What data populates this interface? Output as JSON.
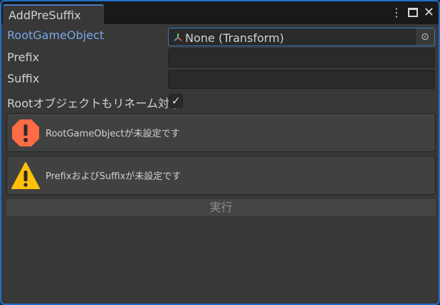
{
  "window": {
    "tab_title": "AddPreSuffix"
  },
  "fields": {
    "root_label": "RootGameObject",
    "root_value": "None (Transform)",
    "prefix_label": "Prefix",
    "prefix_value": "",
    "suffix_label": "Suffix",
    "suffix_value": "",
    "include_root_label": "Rootオブジェクトもリネーム対象",
    "include_root_checked": true
  },
  "messages": [
    {
      "type": "error",
      "text": "RootGameObjectが未設定です"
    },
    {
      "type": "warning",
      "text": "PrefixおよびSuffixが未設定です"
    }
  ],
  "execute_button": "実行",
  "colors": {
    "accent": "#1f6fc6",
    "error": "#ff6b45",
    "warning": "#ffc107",
    "label_highlight": "#7aa7e8"
  }
}
